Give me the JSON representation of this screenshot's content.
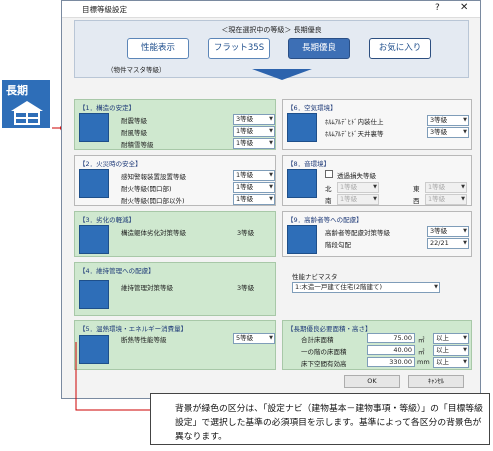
{
  "dialog": {
    "title": "目標等級設定",
    "help": "?",
    "close": "✕"
  },
  "selector": {
    "caption": "＜現在選択中の等級＞ 長期優良",
    "buttons": [
      "性能表示",
      "フラット35S",
      "長期優良",
      "お気に入り"
    ],
    "sub": "（物件マスタ等級）"
  },
  "badge": {
    "text": "長期"
  },
  "sections": {
    "structure": {
      "title": "【1．構造の安定】",
      "rows": [
        {
          "label": "耐震等級",
          "value": "3等級"
        },
        {
          "label": "耐風等級",
          "value": "1等級"
        },
        {
          "label": "耐積雪等級",
          "value": "1等級"
        }
      ]
    },
    "fire": {
      "title": "【2．火災時の安全】",
      "rows": [
        {
          "label": "感知警報装置設置等級",
          "value": "1等級"
        },
        {
          "label": "耐火等級(開口部)",
          "value": "1等級"
        },
        {
          "label": "耐火等級(開口部以外)",
          "value": "1等級"
        }
      ]
    },
    "deterioration": {
      "title": "【3．劣化の軽減】",
      "label": "構造躯体劣化対策等級",
      "value": "3等級"
    },
    "maintenance": {
      "title": "【4．維持管理への配慮】",
      "label": "維持管理対策等級",
      "value": "3等級"
    },
    "thermal": {
      "title": "【5．温熱環境・エネルギー消費量】",
      "label": "断熱等性能等級",
      "value": "5等級"
    },
    "air": {
      "title": "【6．空気環境】",
      "rows": [
        {
          "label": "ﾎﾙﾑｱﾙﾃﾞﾋﾄﾞ内装仕上",
          "value": "3等級"
        },
        {
          "label": "ﾎﾙﾑｱﾙﾃﾞﾋﾄﾞ天井裏等",
          "value": "3等級"
        }
      ]
    },
    "sound": {
      "title": "【8．音環境】",
      "check": "透過損失等級",
      "north": "北",
      "east": "東",
      "south": "南",
      "west": "西",
      "values": [
        "1等級",
        "1等級",
        "1等級",
        "1等級"
      ]
    },
    "elderly": {
      "title": "【9．高齢者等への配慮】",
      "rows": [
        {
          "label": "高齢者等配慮対策等級",
          "value": "3等級"
        },
        {
          "label": "階段勾配",
          "value": "22/21"
        }
      ]
    },
    "navi": {
      "label": "性能ナビマスタ",
      "value": "1:木造一戸建て住宅(2階建て)"
    },
    "area": {
      "title": "【長期優良必要面積・高さ】",
      "rows": [
        {
          "label": "合計床面積",
          "value": "75.00",
          "unit": "㎡",
          "cond": "以上"
        },
        {
          "label": "一の階の床面積",
          "value": "40.00",
          "unit": "㎡",
          "cond": "以上"
        },
        {
          "label": "床下空間有効高",
          "value": "330.00",
          "unit": "mm",
          "cond": "以上"
        }
      ]
    }
  },
  "footer": {
    "ok": "OK",
    "cancel": "ｷｬﾝｾﾙ"
  },
  "callout": {
    "text": "背景が緑色の区分は、「設定ナビ（建物基本－建物事項・等級）」の「目標等級設定」で選択した基準の必須項目を示します。基準によって各区分の背景色が異なります。"
  }
}
